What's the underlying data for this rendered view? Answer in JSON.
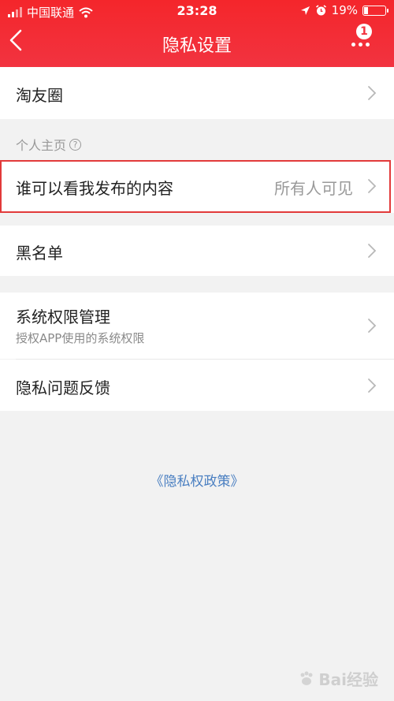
{
  "status_bar": {
    "carrier": "中国联通",
    "time": "23:28",
    "battery": "19%",
    "battery_level": 0.19
  },
  "header": {
    "title": "隐私设置",
    "badge_count": "1",
    "background_color": "#f23340"
  },
  "rows": {
    "taoyouquan": {
      "label": "淘友圈"
    },
    "section_label": "个人主页",
    "who_can_see": {
      "label": "谁可以看我发布的内容",
      "value": "所有人可见"
    },
    "blacklist": {
      "label": "黑名单"
    },
    "system_permission": {
      "label": "系统权限管理",
      "sub": "授权APP使用的系统权限"
    },
    "privacy_feedback": {
      "label": "隐私问题反馈"
    }
  },
  "policy_link": "《隐私权政策》",
  "watermark": "Bai经验",
  "colors": {
    "accent": "#f23340",
    "link": "#4a7fc1",
    "highlight": "#e23a3a"
  },
  "icons": {
    "back": "chevron-left-icon",
    "more": "more-dots-icon",
    "row_arrow": "chevron-right-icon",
    "help": "question-circle-icon"
  }
}
